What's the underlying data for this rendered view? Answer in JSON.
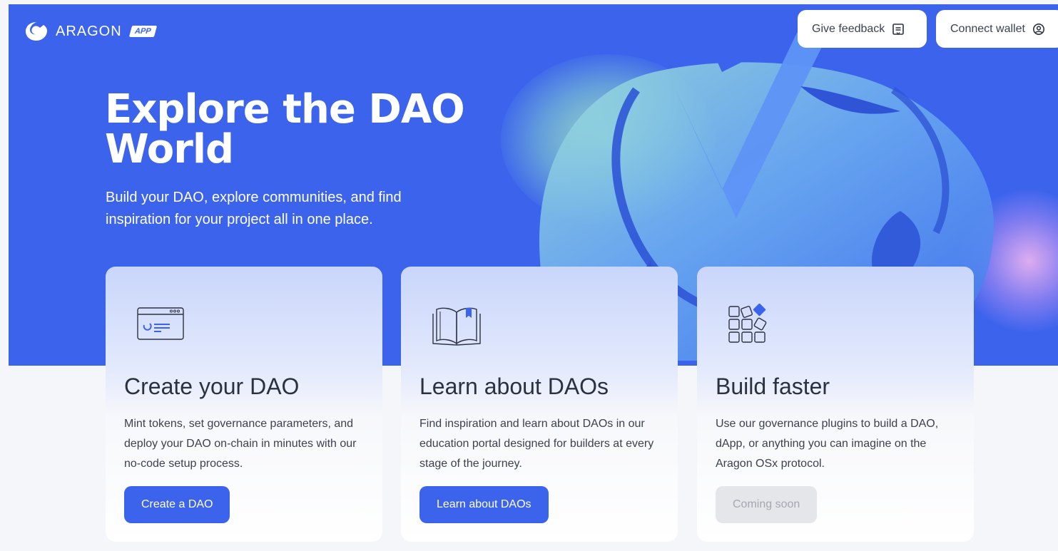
{
  "brand": {
    "name": "ARAGON",
    "badge": "APP"
  },
  "header": {
    "feedback_label": "Give feedback",
    "wallet_label": "Connect wallet"
  },
  "hero": {
    "title": "Explore the DAO World",
    "subtitle": "Build your DAO, explore communities, and find inspiration for your project all in one place."
  },
  "cards": [
    {
      "icon": "browser-window-icon",
      "title": "Create your DAO",
      "description": "Mint tokens, set governance parameters, and deploy your DAO on-chain in minutes with our no-code setup process.",
      "button": "Create a DAO",
      "enabled": true
    },
    {
      "icon": "open-book-icon",
      "title": "Learn about DAOs",
      "description": "Find inspiration and learn about DAOs in our education portal designed for builders at every stage of the journey.",
      "button": "Learn about DAOs",
      "enabled": true
    },
    {
      "icon": "blocks-grid-icon",
      "title": "Build faster",
      "description": "Use our governance plugins to build a DAO, dApp, or anything you can imagine on the Aragon OSx protocol.",
      "button": "Coming soon",
      "enabled": false
    }
  ],
  "colors": {
    "primary": "#3b63ec",
    "text_dark": "#2b3140",
    "text_body": "#3b4150",
    "disabled_bg": "#e4e6ea",
    "disabled_text": "#a3a8b3"
  }
}
